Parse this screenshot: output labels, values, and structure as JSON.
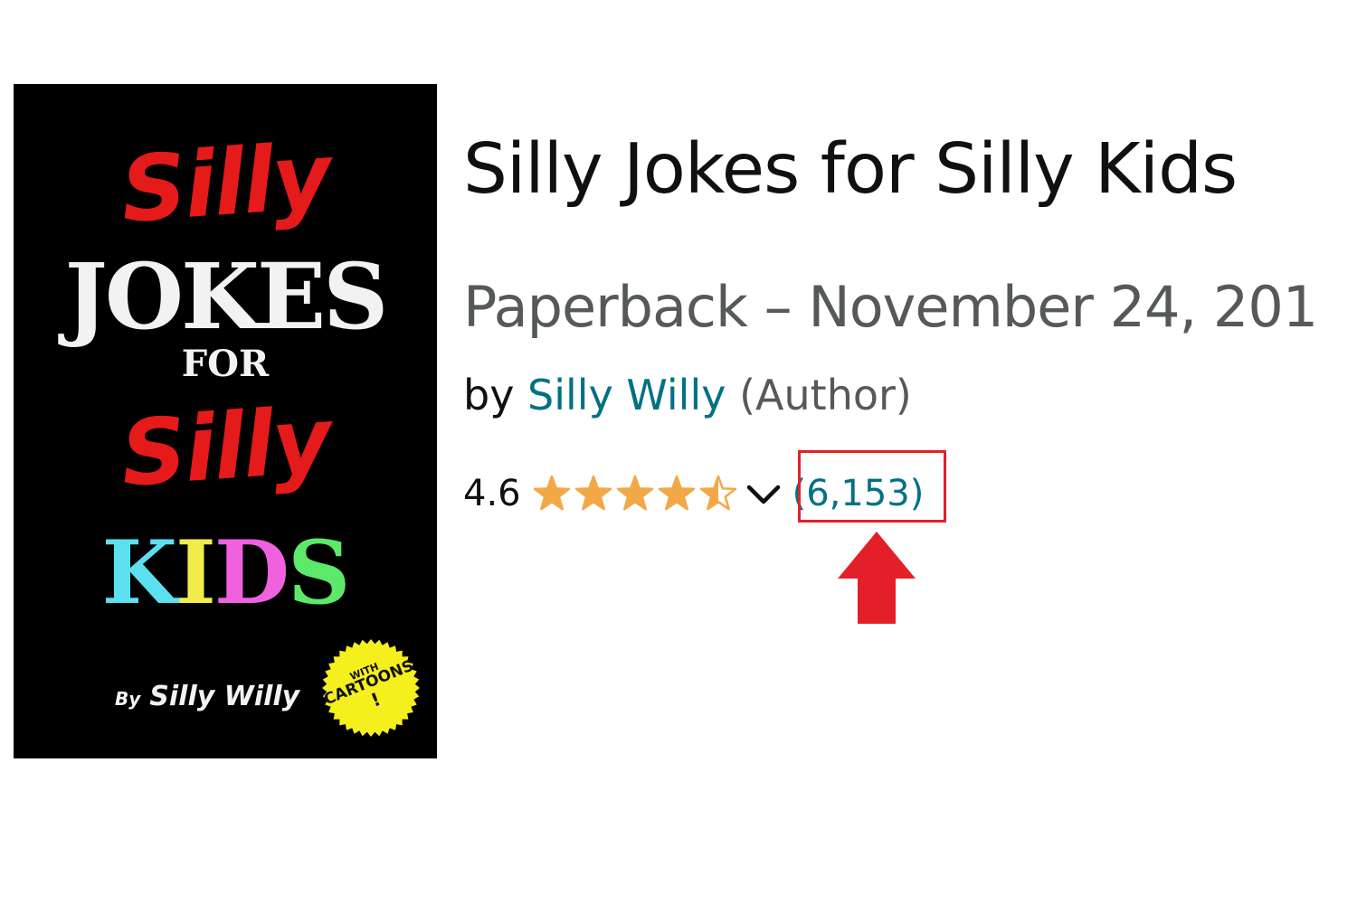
{
  "cover": {
    "line1": "Silly",
    "line2": "JOKES",
    "line3": "FOR",
    "line4": "Silly",
    "kids_letters": [
      {
        "char": "K",
        "color": "#5ce0f0"
      },
      {
        "char": "I",
        "color": "#f2ec4a"
      },
      {
        "char": "D",
        "color": "#f061e0"
      },
      {
        "char": "S",
        "color": "#5ce86a"
      }
    ],
    "by_prefix": "By",
    "by_name": "Silly Willy",
    "badge": {
      "line1": "WITH",
      "line2": "CARTOONS",
      "line3": "!",
      "color": "#f6ef1e"
    },
    "colors": {
      "background": "#000000",
      "silly_red": "#e51a1a",
      "white": "#f2f2f2"
    }
  },
  "product": {
    "title": "Silly Jokes for Silly Kids",
    "subtitle": "Paperback – November 24, 201",
    "by_label": "by",
    "author": "Silly Willy",
    "author_role": "(Author)",
    "rating_value": "4.6",
    "rating_stars": 4.5,
    "rating_max": 5,
    "review_count": "(6,153)",
    "star_color": "#f3a847",
    "link_color": "#007185"
  },
  "annotation": {
    "highlight_color": "#e3202a",
    "arrow_icon": "up-arrow-icon"
  }
}
